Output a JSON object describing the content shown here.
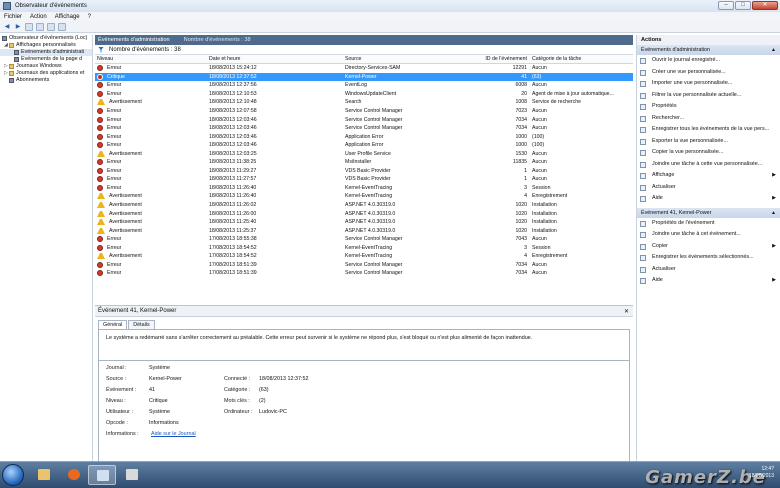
{
  "window": {
    "title": "Observateur d'événements"
  },
  "menu": [
    "Fichier",
    "Action",
    "Affichage",
    "?"
  ],
  "tree": {
    "root": "Observateur d'événements (Loc)",
    "custom_views": "Affichages personnalisés",
    "admin_events": "Événements d'administrati",
    "page_events": "Événements de la page d",
    "windows_logs": "Journaux Windows",
    "app_logs": "Journaux des applications et",
    "subscriptions": "Abonnements"
  },
  "center": {
    "header_title": "Événements d'administration",
    "header_count": "Nombre d'événements : 38",
    "count_bar": "Nombre d'événements : 38",
    "columns": [
      "Niveau",
      "Date et heure",
      "Source",
      "ID de l'événement",
      "Catégorie de la tâche"
    ],
    "rows": [
      {
        "level": "Erreur",
        "type": "err",
        "date": "18/08/2013 15:24:12",
        "source": "Directory-Services-SAM",
        "id": "12291",
        "cat": "Aucun"
      },
      {
        "level": "Critique",
        "type": "crit",
        "date": "18/08/2013 12:37:52",
        "source": "Kernel-Power",
        "id": "41",
        "cat": "(63)",
        "selected": true
      },
      {
        "level": "Erreur",
        "type": "err",
        "date": "18/08/2013 12:37:56",
        "source": "EventLog",
        "id": "6008",
        "cat": "Aucun"
      },
      {
        "level": "Erreur",
        "type": "err",
        "date": "18/08/2013 12:10:53",
        "source": "WindowsUpdateClient",
        "id": "20",
        "cat": "Agent de mise à jour automatique..."
      },
      {
        "level": "Avertissement",
        "type": "warn",
        "date": "18/08/2013 12:10:48",
        "source": "Search",
        "id": "1008",
        "cat": "Service de recherche"
      },
      {
        "level": "Erreur",
        "type": "err",
        "date": "18/08/2013 12:07:58",
        "source": "Service Control Manager",
        "id": "7023",
        "cat": "Aucun"
      },
      {
        "level": "Erreur",
        "type": "err",
        "date": "18/08/2013 12:03:46",
        "source": "Service Control Manager",
        "id": "7034",
        "cat": "Aucun"
      },
      {
        "level": "Erreur",
        "type": "err",
        "date": "18/08/2013 12:03:46",
        "source": "Service Control Manager",
        "id": "7034",
        "cat": "Aucun"
      },
      {
        "level": "Erreur",
        "type": "err",
        "date": "18/08/2013 12:03:46",
        "source": "Application Error",
        "id": "1000",
        "cat": "(100)"
      },
      {
        "level": "Erreur",
        "type": "err",
        "date": "18/08/2013 12:03:46",
        "source": "Application Error",
        "id": "1000",
        "cat": "(100)"
      },
      {
        "level": "Avertissement",
        "type": "warn",
        "date": "18/08/2013 12:03:25",
        "source": "User Profile Service",
        "id": "1530",
        "cat": "Aucun"
      },
      {
        "level": "Erreur",
        "type": "err",
        "date": "18/08/2013 11:38:25",
        "source": "MsiInstaller",
        "id": "11835",
        "cat": "Aucun"
      },
      {
        "level": "Erreur",
        "type": "err",
        "date": "18/08/2013 11:29:27",
        "source": "VDS Basic Provider",
        "id": "1",
        "cat": "Aucun"
      },
      {
        "level": "Erreur",
        "type": "err",
        "date": "18/08/2013 11:27:57",
        "source": "VDS Basic Provider",
        "id": "1",
        "cat": "Aucun"
      },
      {
        "level": "Erreur",
        "type": "err",
        "date": "18/08/2013 11:26:40",
        "source": "Kernel-EventTracing",
        "id": "3",
        "cat": "Session"
      },
      {
        "level": "Avertissement",
        "type": "warn",
        "date": "18/08/2013 11:26:40",
        "source": "Kernel-EventTracing",
        "id": "4",
        "cat": "Enregistrement"
      },
      {
        "level": "Avertissement",
        "type": "warn",
        "date": "18/08/2013 11:26:02",
        "source": "ASP.NET 4.0.30319.0",
        "id": "1020",
        "cat": "Installation"
      },
      {
        "level": "Avertissement",
        "type": "warn",
        "date": "18/08/2013 11:26:00",
        "source": "ASP.NET 4.0.30319.0",
        "id": "1020",
        "cat": "Installation"
      },
      {
        "level": "Avertissement",
        "type": "warn",
        "date": "18/08/2013 11:25:40",
        "source": "ASP.NET 4.0.30319.0",
        "id": "1020",
        "cat": "Installation"
      },
      {
        "level": "Avertissement",
        "type": "warn",
        "date": "18/08/2013 11:25:37",
        "source": "ASP.NET 4.0.30319.0",
        "id": "1020",
        "cat": "Installation"
      },
      {
        "level": "Erreur",
        "type": "err",
        "date": "17/08/2013 18:55:38",
        "source": "Service Control Manager",
        "id": "7043",
        "cat": "Aucun"
      },
      {
        "level": "Erreur",
        "type": "err",
        "date": "17/08/2013 18:54:52",
        "source": "Kernel-EventTracing",
        "id": "3",
        "cat": "Session"
      },
      {
        "level": "Avertissement",
        "type": "warn",
        "date": "17/08/2013 18:54:52",
        "source": "Kernel-EventTracing",
        "id": "4",
        "cat": "Enregistrement"
      },
      {
        "level": "Erreur",
        "type": "err",
        "date": "17/08/2013 18:51:39",
        "source": "Service Control Manager",
        "id": "7034",
        "cat": "Aucun"
      },
      {
        "level": "Erreur",
        "type": "err",
        "date": "17/08/2013 18:51:39",
        "source": "Service Control Manager",
        "id": "7034",
        "cat": "Aucun"
      }
    ]
  },
  "detail": {
    "title": "Événement 41, Kernel-Power",
    "close": "✕",
    "tab_general": "Général",
    "tab_details": "Détails",
    "message": "Le système a redémarré sans s'arrêter correctement au préalable. Cette erreur peut survenir si le système ne répond plus, s'est bloqué ou n'est plus alimenté de façon inattendue.",
    "labels": {
      "journal": "Journal :",
      "source": "Source :",
      "event": "Événement :",
      "level": "Niveau :",
      "user": "Utilisateur :",
      "opcode": "Opcode :",
      "info": "Informations :",
      "logged": "Connecté :",
      "category": "Catégorie :",
      "keywords": "Mots clés :",
      "computer": "Ordinateur :"
    },
    "values": {
      "journal": "Système",
      "source": "Kernel-Power",
      "event": "41",
      "level": "Critique",
      "user": "Système",
      "opcode": "Informations",
      "info": "Aide sur le Journal",
      "logged": "18/08/2013 12:37:52",
      "category": "(63)",
      "keywords": "(2)",
      "computer": "Ludovic-PC"
    }
  },
  "actions": {
    "title": "Actions",
    "section1": "Événements d'administration",
    "items1": [
      "Ouvrir le journal enregistré...",
      "Créer une vue personnalisée...",
      "Importer une vue personnalisée...",
      "Filtrer la vue personnalisée actuelle...",
      "Propriétés",
      "Rechercher...",
      "Enregistrer tous les événements de la vue pers...",
      "Exporter la vue personnalisée...",
      "Copier la vue personnalisée...",
      "Joindre une tâche à cette vue personnalisée...",
      "Affichage",
      "Actualiser",
      "Aide"
    ],
    "section2": "Événement 41, Kernel-Power",
    "items2": [
      "Propriétés de l'événement",
      "Joindre une tâche à cet événement...",
      "Copier",
      "Enregistrer les événements sélectionnés...",
      "Actualiser",
      "Aide"
    ]
  },
  "taskbar": {
    "lang": "FR",
    "time": "12:4?",
    "date": "18/08/2013",
    "watermark": "GamerZ.be"
  }
}
